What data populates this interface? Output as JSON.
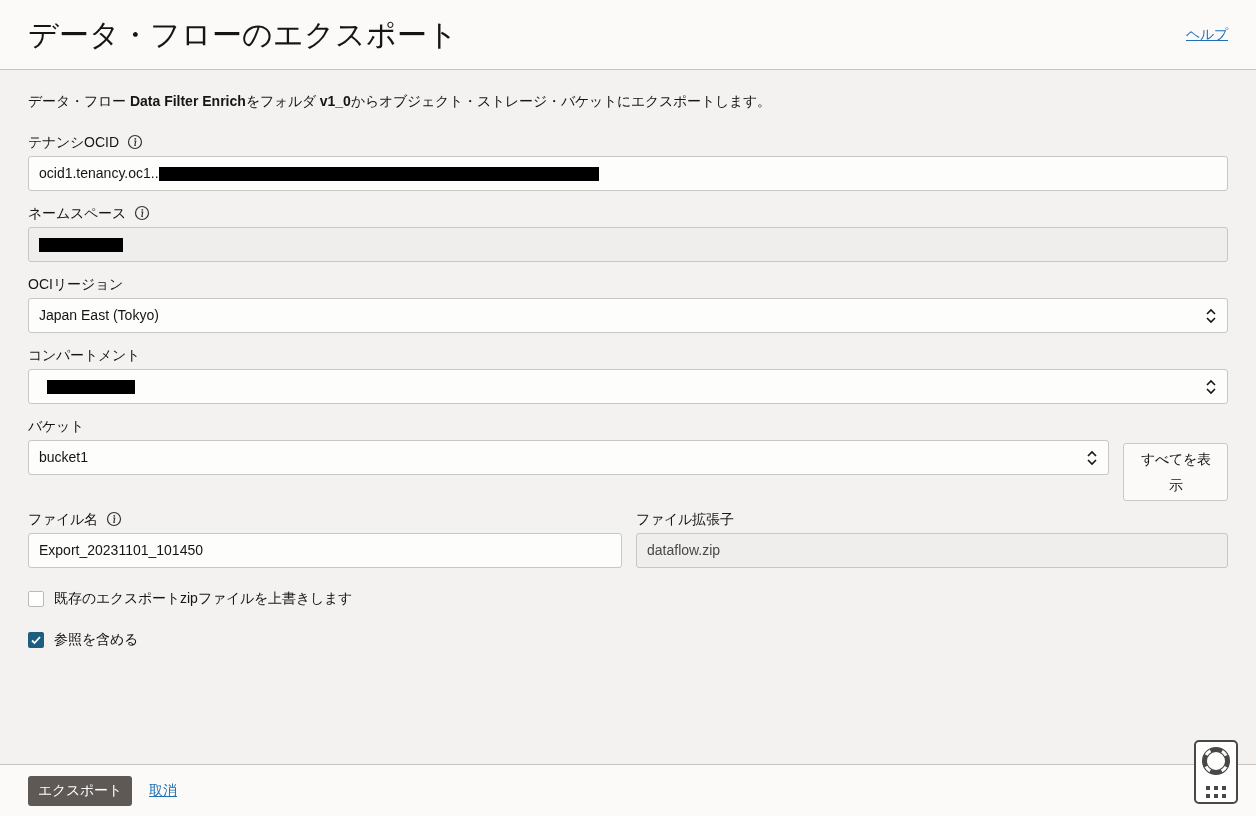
{
  "header": {
    "title": "データ・フローのエクスポート",
    "help_link": "ヘルプ"
  },
  "description": "データ・フロー **Data Filter Enrich**をフォルダ **v1_0**からオブジェクト・ストレージ・バケットにエクスポートします。",
  "fields": [
    {
      "kind": "text",
      "label": "テナンシOCID",
      "info": true,
      "value": "ocid1.tenancy.oc1..",
      "redacted": true
    },
    {
      "kind": "readonly",
      "label": "ネームスペース",
      "info": true,
      "redacted": true
    },
    {
      "kind": "select",
      "label": "OCIリージョン",
      "info": false,
      "value": "Japan East (Tokyo)",
      "redacted": false
    },
    {
      "kind": "select",
      "label": "コンパートメント",
      "info": false,
      "redacted": true
    }
  ],
  "bucket": {
    "label": "バケット",
    "value": "bucket1",
    "show_all_button": "すべてを表示"
  },
  "file_name": {
    "label": "ファイル名",
    "info": true,
    "value": "Export_20231101_101450"
  },
  "file_extension": {
    "label": "ファイル拡張子",
    "value": "dataflow.zip"
  },
  "options": [
    {
      "label": "既存のエクスポートzipファイルを上書きします",
      "checked": false
    },
    {
      "label": "参照を含める",
      "checked": true
    }
  ],
  "footer": {
    "export_button": "エクスポート",
    "cancel_link": "取消"
  }
}
